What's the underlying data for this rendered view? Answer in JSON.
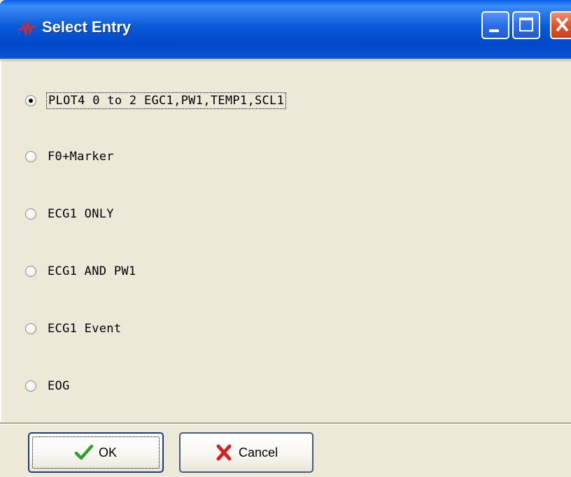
{
  "window": {
    "title": "Select Entry",
    "controls": {
      "minimize": "minimize-icon",
      "maximize": "maximize-icon",
      "close": "close-icon"
    }
  },
  "options": [
    {
      "label": "PLOT4 0 to 2 EGC1,PW1,TEMP1,SCL1",
      "checked": true
    },
    {
      "label": "F0+Marker",
      "checked": false
    },
    {
      "label": "ECG1 ONLY",
      "checked": false
    },
    {
      "label": "ECG1 AND PW1",
      "checked": false
    },
    {
      "label": "ECG1 Event",
      "checked": false
    },
    {
      "label": "EOG",
      "checked": false
    }
  ],
  "buttons": {
    "ok_label": "OK",
    "cancel_label": "Cancel"
  },
  "colors": {
    "titlebar": "#0a54d6",
    "close_button": "#e0542a",
    "ok_check": "#2e9e2e",
    "cancel_x": "#d42020"
  }
}
